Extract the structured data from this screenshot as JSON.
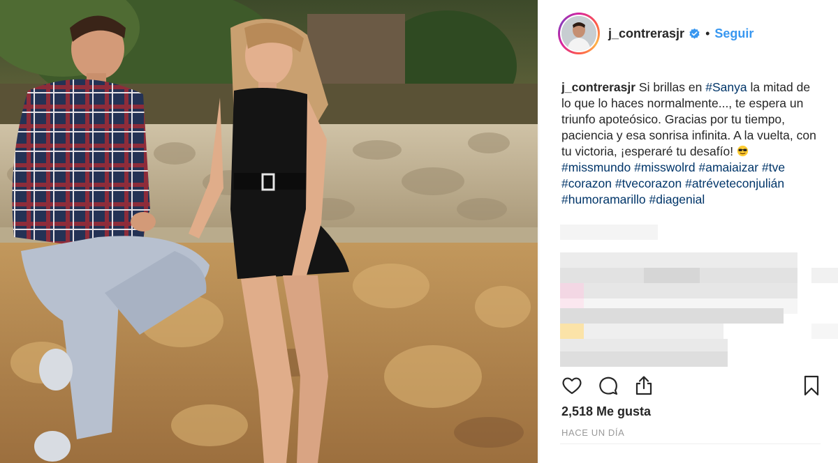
{
  "post": {
    "username": "j_contrerasjr",
    "separator": "•",
    "follow_label": "Seguir",
    "caption": {
      "username": "j_contrerasjr",
      "text_1": "Si brillas en",
      "tag_1": "#Sanya",
      "text_2": "la mitad de lo que lo haces normalmente..., te espera un triunfo apoteósico. Gracias por tu tiempo, paciencia y esa sonrisa infinita. A la vuelta, con tu victoria, ¡esperaré tu desafío!",
      "emoji": "sunglasses-emoji",
      "hashtags": [
        "#missmundo",
        "#misswolrd",
        "#amaiaizar",
        "#tve",
        "#corazon",
        "#tvecorazon",
        "#atréveteconjulián",
        "#humoramarillo",
        "#diagenial"
      ]
    },
    "likes": "2,518 Me gusta",
    "time_ago": "HACE UN DÍA",
    "icons": {
      "verified": "verified-badge-icon",
      "like": "heart-icon",
      "comment": "comment-icon",
      "share": "share-icon",
      "save": "bookmark-icon"
    },
    "colors": {
      "link": "#3897f0",
      "hashtag": "#003569",
      "text": "#262626",
      "muted": "#999999"
    }
  }
}
